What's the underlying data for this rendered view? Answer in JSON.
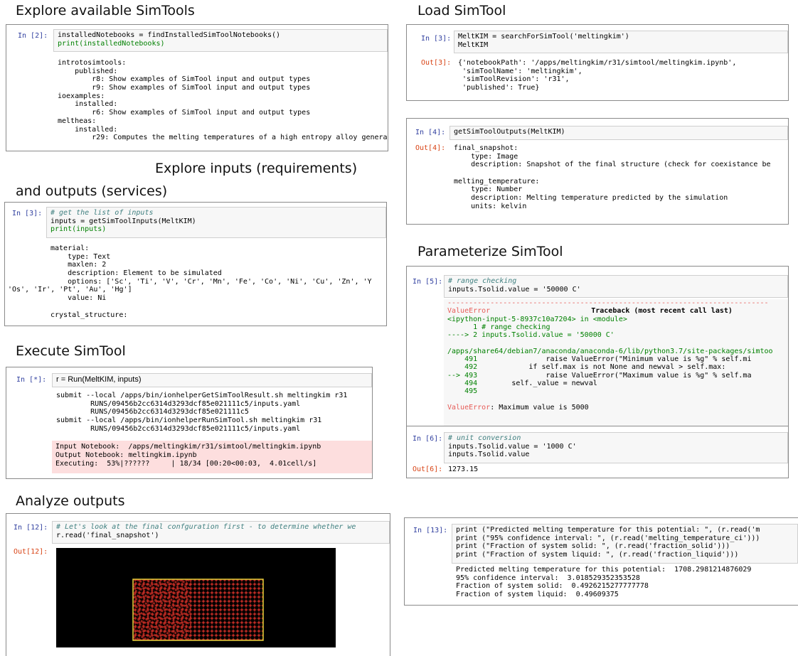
{
  "headings": {
    "explore": "Explore available SimTools",
    "load": "Load SimTool",
    "inputs_line1": "Explore inputs (requirements)",
    "inputs_line2": "and outputs (services)",
    "parameterize": "Parameterize SimTool",
    "execute": "Execute SimTool",
    "analyze": "Analyze outputs"
  },
  "cell_explore": {
    "prompt": "In [2]:",
    "code": [
      "installedNotebooks = findInstalledSimToolNotebooks()",
      "print(installedNotebooks)"
    ],
    "output": [
      "introtosimtools:",
      "    published:",
      "        r8: Show examples of SimTool input and output types",
      "        r9: Show examples of SimTool input and output types",
      "ioexamples:",
      "    installed:",
      "        r6: Show examples of SimTool input and output types",
      "meltheas:",
      "    installed:",
      "        r29: Computes the melting temperatures of a high entropy alloy generat"
    ]
  },
  "cell_load": {
    "prompt": "In [3]:",
    "code": [
      "MeltKIM = searchForSimTool('meltingkim')",
      "MeltKIM"
    ],
    "out_prompt": "Out[3]:",
    "output": [
      "{'notebookPath': '/apps/meltingkim/r31/simtool/meltingkim.ipynb',",
      " 'simToolName': 'meltingkim',",
      " 'simToolRevision': 'r31',",
      " 'published': True}"
    ]
  },
  "cell_outputs": {
    "prompt": "In [4]:",
    "code": "getSimToolOutputs(MeltKIM)",
    "out_prompt": "Out[4]:",
    "output": [
      "final_snapshot:",
      "    type: Image",
      "    description: Snapshot of the final structure (check for coexistance be",
      "",
      "melting_temperature:",
      "    type: Number",
      "    description: Melting temperature predicted by the simulation",
      "    units: kelvin"
    ]
  },
  "cell_inputs": {
    "prompt": "In [3]:",
    "code": [
      "# get the list of inputs",
      "inputs = getSimToolInputs(MeltKIM)",
      "print(inputs)"
    ],
    "output": [
      "material:",
      "    type: Text",
      "    maxlen: 2",
      "    description: Element to be simulated",
      "    options: ['Sc', 'Ti', 'V', 'Cr', 'Mn', 'Fe', 'Co', 'Ni', 'Cu', 'Zn', 'Y",
      "'Os', 'Ir', 'Pt', 'Au', 'Hg']",
      "    value: Ni",
      "",
      "crystal_structure:"
    ]
  },
  "cell_param": {
    "prompt": "In [5]:",
    "code": [
      "# range checking",
      "inputs.Tsolid.value = '50000 C'"
    ],
    "error": {
      "dashes": "---------------------------------------------------------------------------",
      "name": "ValueError",
      "traceback": "Traceback (most recent call last)",
      "ipython": "<ipython-input-5-8937c10a7204> in <module>",
      "l1": "      1 # range checking",
      "l2": "----> 2 inputs.Tsolid.value = '50000 C'",
      "path": "/apps/share64/debian7/anaconda/anaconda-6/lib/python3.7/site-packages/simtoo",
      "n491": "    491",
      "t491": "                raise ValueError(\"Minimum value is %g\" % self.mi",
      "n492": "    492",
      "t492": "            if self.max is not None and newval > self.max:",
      "n493": "--> 493",
      "t493": "                raise ValueError(\"Maximum value is %g\" % self.ma",
      "n494": "    494",
      "t494": "        self._value = newval",
      "n495": "    495",
      "final_name": "ValueError",
      "final_msg": ": Maximum value is 5000"
    }
  },
  "cell_convert": {
    "prompt": "In [6]:",
    "code": [
      "# unit conversion",
      "inputs.Tsolid.value = '1000 C'",
      "inputs.Tsolid.value"
    ],
    "out_prompt": "Out[6]:",
    "output": "1273.15"
  },
  "cell_run": {
    "prompt": "In [*]:",
    "code": "r = Run(MeltKIM, inputs)",
    "output": [
      "submit --local /apps/bin/ionhelperGetSimToolResult.sh meltingkim r31",
      "        RUNS/09456b2cc6314d3293dcf85e021111c5/inputs.yaml",
      "        RUNS/09456b2cc6314d3293dcf85e021111c5",
      "submit --local /apps/bin/ionhelperRunSimTool.sh meltingkim r31",
      "        RUNS/09456b2cc6314d3293dcf85e021111c5/inputs.yaml"
    ],
    "stderr": [
      "Input Notebook:  /apps/meltingkim/r31/simtool/meltingkim.ipynb",
      "Output Notebook: meltingkim.ipynb",
      "Executing:  53%|??????     | 18/34 [00:20<00:03,  4.01cell/s]"
    ],
    "progress": 0.53
  },
  "cell_analyze": {
    "prompt": "In [12]:",
    "code": [
      "# Let's look at the final confguration first - to determine whether we",
      "r.read('final_snapshot')"
    ],
    "out_prompt": "Out[12]:"
  },
  "cell_print": {
    "prompt": "In [13]:",
    "code": [
      "print (\"Predicted melting temperature for this potential: \", (r.read('m",
      "print (\"95% confidence interval: \", (r.read('melting_temperature_ci')))",
      "print (\"Fraction of system solid: \", (r.read('fraction_solid')))",
      "print (\"Fraction of system liquid: \", (r.read('fraction_liquid')))"
    ],
    "output": [
      "Predicted melting temperature for this potential:  1708.2981214876029",
      "95% confidence interval:  3.018529352353528",
      "Fraction of system solid:  0.4926215277777778",
      "Fraction of system liquid:  0.49609375"
    ]
  }
}
